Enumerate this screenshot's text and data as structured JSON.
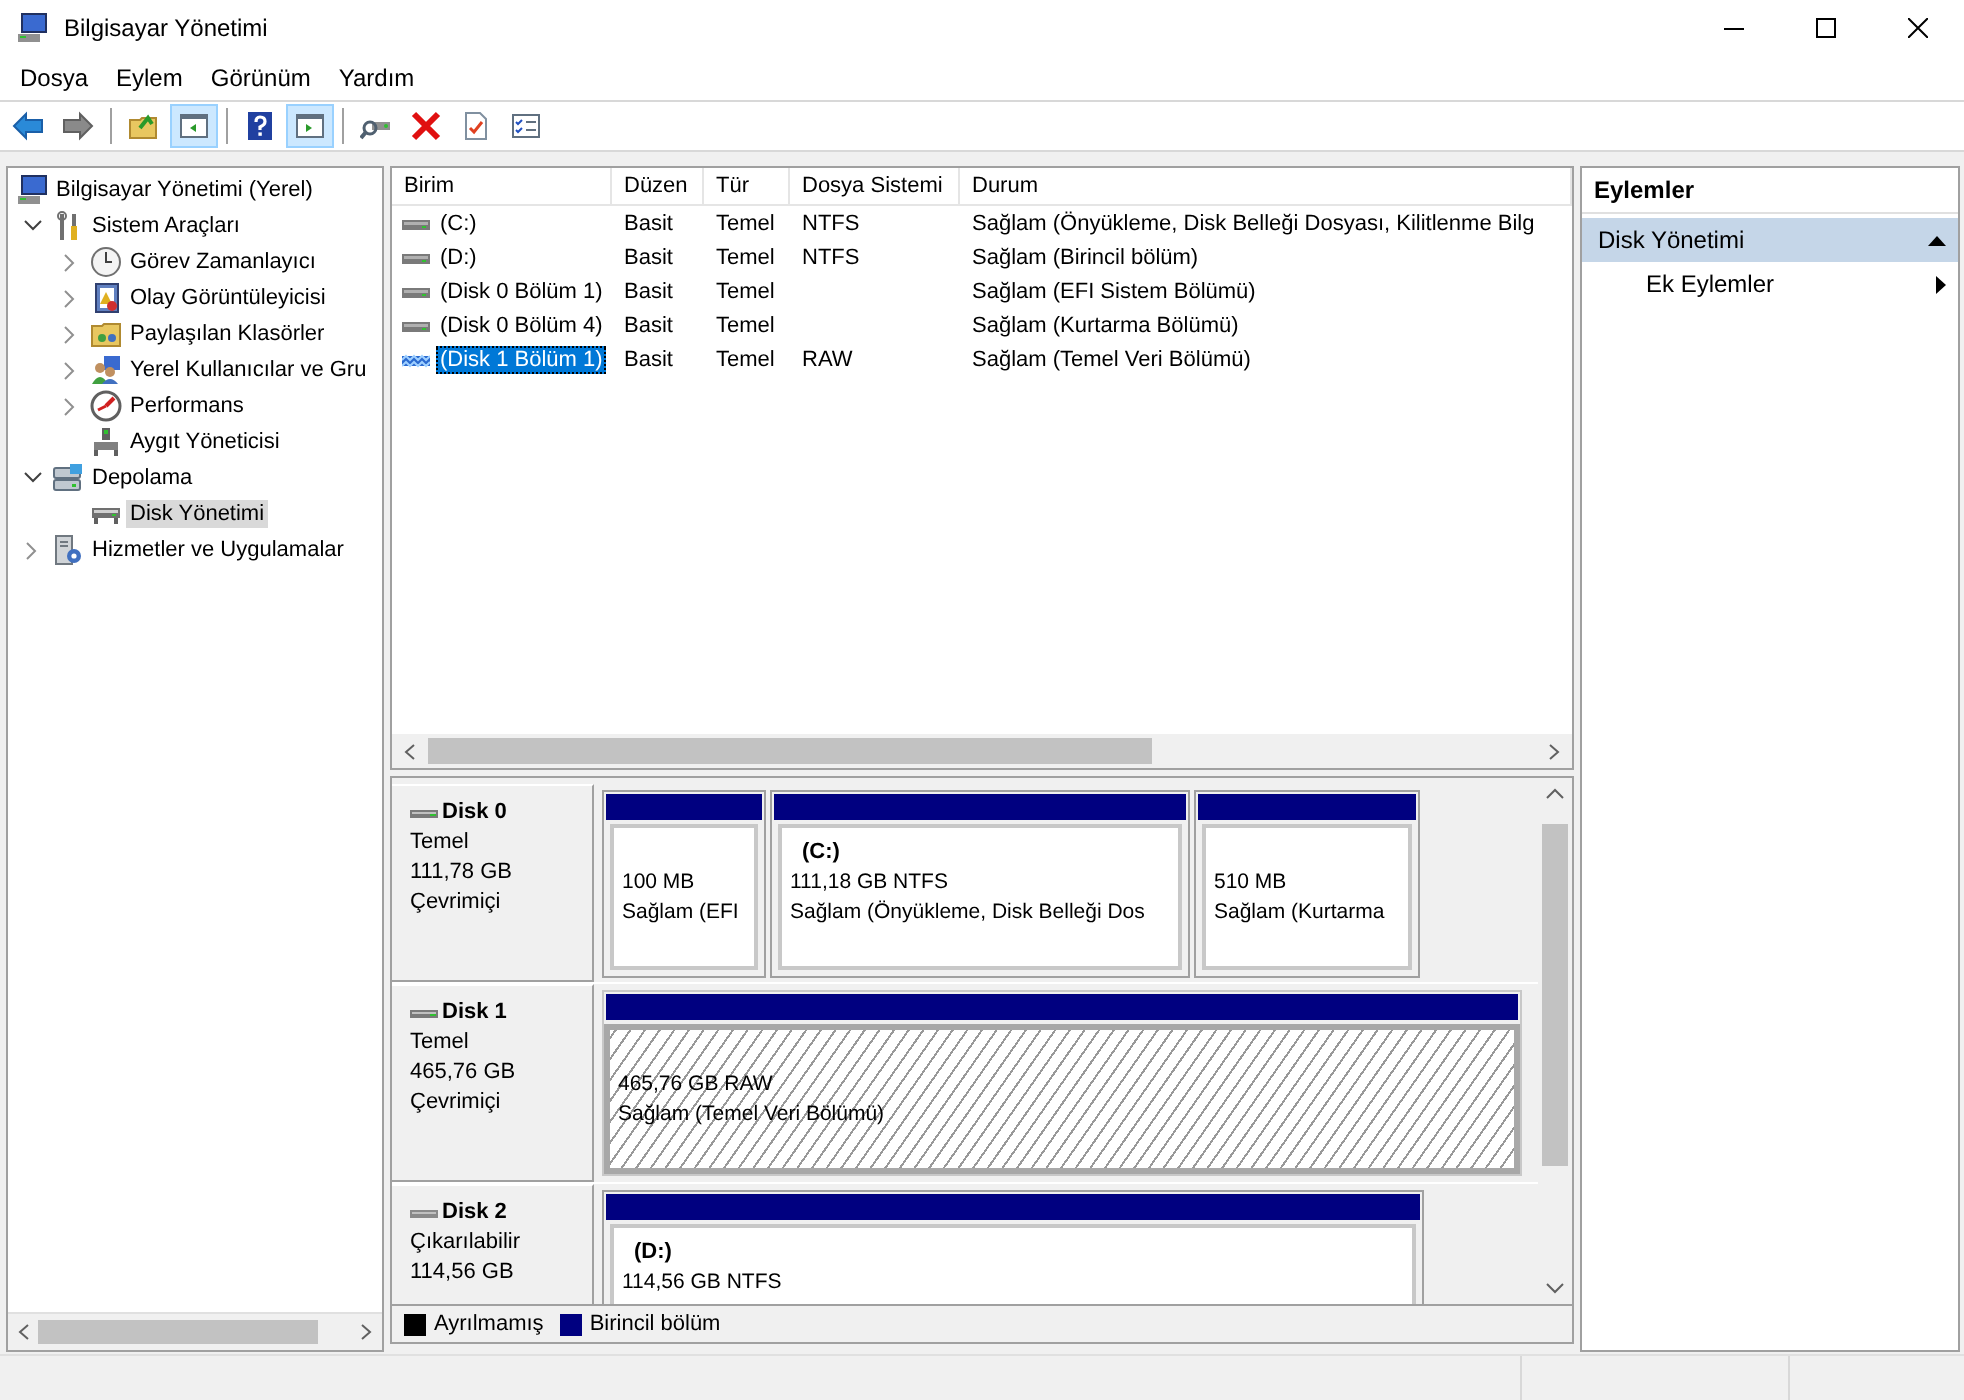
{
  "window": {
    "title": "Bilgisayar Yönetimi"
  },
  "menu": [
    "Dosya",
    "Eylem",
    "Görünüm",
    "Yardım"
  ],
  "toolbar": [
    {
      "kind": "back",
      "pressed": false
    },
    {
      "kind": "forward",
      "pressed": false
    },
    {
      "kind": "sep"
    },
    {
      "kind": "up",
      "pressed": false
    },
    {
      "kind": "tree",
      "pressed": true
    },
    {
      "kind": "sep"
    },
    {
      "kind": "help",
      "pressed": false
    },
    {
      "kind": "pane",
      "pressed": true
    },
    {
      "kind": "sep"
    },
    {
      "kind": "connect",
      "pressed": false
    },
    {
      "kind": "delete",
      "pressed": false
    },
    {
      "kind": "properties",
      "pressed": false
    },
    {
      "kind": "list",
      "pressed": false
    }
  ],
  "tree": [
    {
      "label": "Bilgisayar Yönetimi (Yerel)",
      "kind": "computer",
      "selected": false,
      "children": [
        {
          "label": "Sistem Araçları",
          "kind": "tools",
          "expanded": true,
          "selected": false,
          "children": [
            {
              "label": "Görev Zamanlayıcı",
              "kind": "clock",
              "expanded": false,
              "selected": false
            },
            {
              "label": "Olay Görüntüleyicisi",
              "kind": "events",
              "expanded": false,
              "selected": false
            },
            {
              "label": "Paylaşılan Klasörler",
              "kind": "shared",
              "expanded": false,
              "selected": false
            },
            {
              "label": "Yerel Kullanıcılar ve Gru",
              "kind": "users",
              "expanded": false,
              "selected": false
            },
            {
              "label": "Performans",
              "kind": "perf",
              "expanded": false,
              "selected": false
            },
            {
              "label": "Aygıt Yöneticisi",
              "kind": "device",
              "selected": false
            }
          ]
        },
        {
          "label": "Depolama",
          "kind": "storage",
          "expanded": true,
          "selected": false,
          "children": [
            {
              "label": "Disk Yönetimi",
              "kind": "disk",
              "selected": true
            }
          ]
        },
        {
          "label": "Hizmetler ve Uygulamalar",
          "kind": "services",
          "expanded": false,
          "selected": false
        }
      ]
    }
  ],
  "volumes": {
    "columns": [
      "Birim",
      "Düzen",
      "Tür",
      "Dosya Sistemi",
      "Durum"
    ],
    "rows": [
      {
        "kind": "basic",
        "selected": false,
        "cells": [
          "(C:)",
          "Basit",
          "Temel",
          "NTFS",
          "Sağlam (Önyükleme, Disk Belleği Dosyası, Kilitlenme Bilg"
        ]
      },
      {
        "kind": "basic",
        "selected": false,
        "cells": [
          "(D:)",
          "Basit",
          "Temel",
          "NTFS",
          "Sağlam (Birincil bölüm)"
        ]
      },
      {
        "kind": "basic",
        "selected": false,
        "cells": [
          "(Disk 0 Bölüm 1)",
          "Basit",
          "Temel",
          "",
          "Sağlam (EFI Sistem Bölümü)"
        ]
      },
      {
        "kind": "basic",
        "selected": false,
        "cells": [
          "(Disk 0 Bölüm 4)",
          "Basit",
          "Temel",
          "",
          "Sağlam (Kurtarma Bölümü)"
        ]
      },
      {
        "kind": "raw",
        "selected": true,
        "cells": [
          "(Disk 1 Bölüm 1)",
          "Basit",
          "Temel",
          "RAW",
          "Sağlam (Temel Veri Bölümü)"
        ]
      }
    ]
  },
  "disks": [
    {
      "name": "Disk 0",
      "kind": "fixed",
      "type": "Temel",
      "size": "111,78 GB",
      "status": "Çevrimiçi",
      "partitions": [
        {
          "size": "100 MB",
          "status": "Sağlam (EFI",
          "selected": false
        },
        {
          "label": "(C:)",
          "size": "111,18 GB NTFS",
          "status": "Sağlam (Önyükleme, Disk Belleği Dos",
          "selected": false
        },
        {
          "size": "510 MB",
          "status": "Sağlam (Kurtarma",
          "selected": false
        }
      ]
    },
    {
      "name": "Disk 1",
      "kind": "fixed",
      "type": "Temel",
      "size": "465,76 GB",
      "status": "Çevrimiçi",
      "partitions": [
        {
          "size": "465,76 GB RAW",
          "status": "Sağlam (Temel Veri Bölümü)",
          "selected": true
        }
      ]
    },
    {
      "name": "Disk 2",
      "kind": "removable",
      "type": "Çıkarılabilir",
      "size": "114,56 GB",
      "partitions": [
        {
          "label": "(D:)",
          "size": "114,56 GB NTFS",
          "selected": false
        }
      ]
    }
  ],
  "legend": [
    {
      "label": "Ayrılmamış",
      "color": "#000000"
    },
    {
      "label": "Birincil bölüm",
      "color": "#000080"
    }
  ],
  "actions": {
    "header": "Eylemler",
    "items": [
      {
        "label": "Disk Yönetimi",
        "kind": "section",
        "expanded": true
      },
      {
        "label": "Ek Eylemler",
        "kind": "submenu"
      }
    ]
  }
}
